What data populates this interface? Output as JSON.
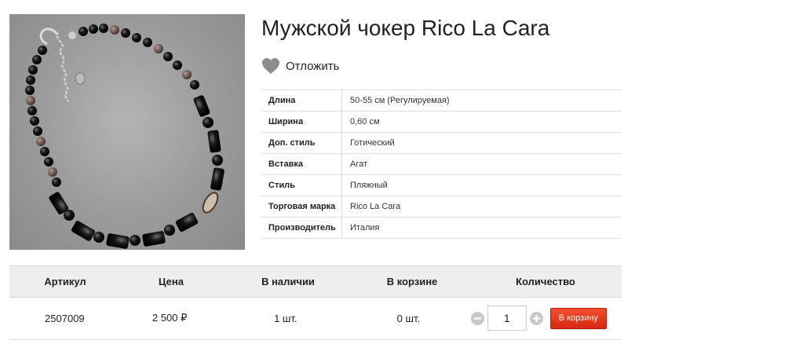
{
  "product": {
    "title": "Мужской чокер Rico La Cara",
    "image_icon": "necklace-photo"
  },
  "wishlist": {
    "icon": "heart-icon",
    "label": "Отложить",
    "icon_color": "#8c8c8c"
  },
  "specs": [
    {
      "key": "Длина",
      "value": "50-55 см (Регулируемая)"
    },
    {
      "key": "Ширина",
      "value": "0,60 см"
    },
    {
      "key": "Доп. стиль",
      "value": "Готический"
    },
    {
      "key": "Вставка",
      "value": "Агат"
    },
    {
      "key": "Стиль",
      "value": "Пляжный"
    },
    {
      "key": "Торговая марка",
      "value": "Rico La Cara"
    },
    {
      "key": "Производитель",
      "value": "Италия"
    }
  ],
  "purchase": {
    "headers": {
      "sku": "Артикул",
      "price": "Цена",
      "stock": "В наличии",
      "in_cart": "В корзине",
      "quantity": "Количество"
    },
    "row": {
      "sku": "2507009",
      "price": "2 500 ₽",
      "stock": "1 шт.",
      "in_cart": "0 шт.",
      "quantity": "1"
    },
    "decrease_icon": "minus-icon",
    "increase_icon": "plus-icon",
    "add_button_label": "В корзину"
  },
  "colors": {
    "button": "#e2371a",
    "header_bg": "#eeeeee",
    "border": "#dddddd"
  }
}
